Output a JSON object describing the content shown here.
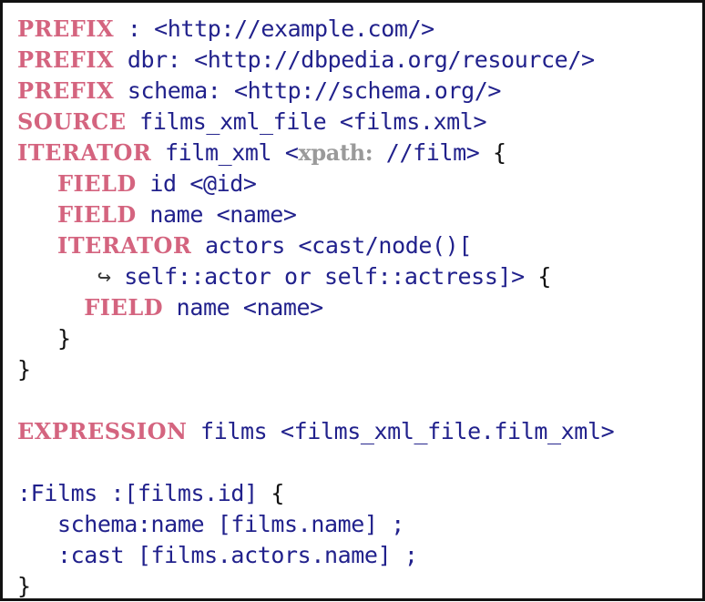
{
  "figure": {
    "name": "shexml-mapping-code-listing",
    "language": "ShExML",
    "background_color": "#ffffff",
    "border_color": "#111111",
    "keyword_color": "#d4647f",
    "text_color": "#21218c",
    "driver_color": "#9a9a9a",
    "brace_color": "#111111"
  },
  "lines": [
    {
      "id": "line-1",
      "tokens": [
        {
          "kind": "keyword",
          "text": "PREFIX"
        },
        {
          "kind": "text",
          "text": " : <http://example.com/>"
        }
      ]
    },
    {
      "id": "line-2",
      "tokens": [
        {
          "kind": "keyword",
          "text": "PREFIX"
        },
        {
          "kind": "text",
          "text": " dbr: <http://dbpedia.org/resource/>"
        }
      ]
    },
    {
      "id": "line-3",
      "tokens": [
        {
          "kind": "keyword",
          "text": "PREFIX"
        },
        {
          "kind": "text",
          "text": " schema: <http://schema.org/>"
        }
      ]
    },
    {
      "id": "line-4",
      "tokens": [
        {
          "kind": "keyword",
          "text": "SOURCE"
        },
        {
          "kind": "text",
          "text": " films_xml_file <films.xml>"
        }
      ]
    },
    {
      "id": "line-5",
      "tokens": [
        {
          "kind": "keyword",
          "text": "ITERATOR"
        },
        {
          "kind": "text",
          "text": " film_xml <"
        },
        {
          "kind": "driver",
          "text": "xpath:"
        },
        {
          "kind": "text",
          "text": " //film> "
        },
        {
          "kind": "brace",
          "text": "{"
        }
      ]
    },
    {
      "id": "line-6",
      "tokens": [
        {
          "kind": "text",
          "text": "   "
        },
        {
          "kind": "keyword",
          "text": "FIELD"
        },
        {
          "kind": "text",
          "text": " id <@id>"
        }
      ]
    },
    {
      "id": "line-7",
      "tokens": [
        {
          "kind": "text",
          "text": "   "
        },
        {
          "kind": "keyword",
          "text": "FIELD"
        },
        {
          "kind": "text",
          "text": " name <name>"
        }
      ]
    },
    {
      "id": "line-8",
      "tokens": [
        {
          "kind": "text",
          "text": "   "
        },
        {
          "kind": "keyword",
          "text": "ITERATOR"
        },
        {
          "kind": "text",
          "text": " actors <cast/node()["
        }
      ]
    },
    {
      "id": "line-9",
      "tokens": [
        {
          "kind": "text",
          "text": "      "
        },
        {
          "kind": "arrow",
          "text": "↪"
        },
        {
          "kind": "text",
          "text": " self::actor or self::actress]> "
        },
        {
          "kind": "brace",
          "text": "{"
        }
      ]
    },
    {
      "id": "line-10",
      "tokens": [
        {
          "kind": "text",
          "text": "     "
        },
        {
          "kind": "keyword",
          "text": "FIELD"
        },
        {
          "kind": "text",
          "text": " name <name>"
        }
      ]
    },
    {
      "id": "line-11",
      "tokens": [
        {
          "kind": "text",
          "text": "   "
        },
        {
          "kind": "brace",
          "text": "}"
        }
      ]
    },
    {
      "id": "line-12",
      "tokens": [
        {
          "kind": "brace",
          "text": "}"
        }
      ]
    },
    {
      "id": "line-13",
      "blank": true,
      "tokens": [
        {
          "kind": "text",
          "text": " "
        }
      ]
    },
    {
      "id": "line-14",
      "tokens": [
        {
          "kind": "keyword",
          "text": "EXPRESSION"
        },
        {
          "kind": "text",
          "text": " films <films_xml_file.film_xml>"
        }
      ]
    },
    {
      "id": "line-15",
      "blank": true,
      "tokens": [
        {
          "kind": "text",
          "text": " "
        }
      ]
    },
    {
      "id": "line-16",
      "tokens": [
        {
          "kind": "text",
          "text": ":Films :[films.id] "
        },
        {
          "kind": "brace",
          "text": "{"
        }
      ]
    },
    {
      "id": "line-17",
      "tokens": [
        {
          "kind": "text",
          "text": "   schema:name [films.name] ;"
        }
      ]
    },
    {
      "id": "line-18",
      "tokens": [
        {
          "kind": "text",
          "text": "   :cast [films.actors.name] ;"
        }
      ]
    },
    {
      "id": "line-19",
      "tokens": [
        {
          "kind": "brace",
          "text": "}"
        }
      ]
    }
  ]
}
